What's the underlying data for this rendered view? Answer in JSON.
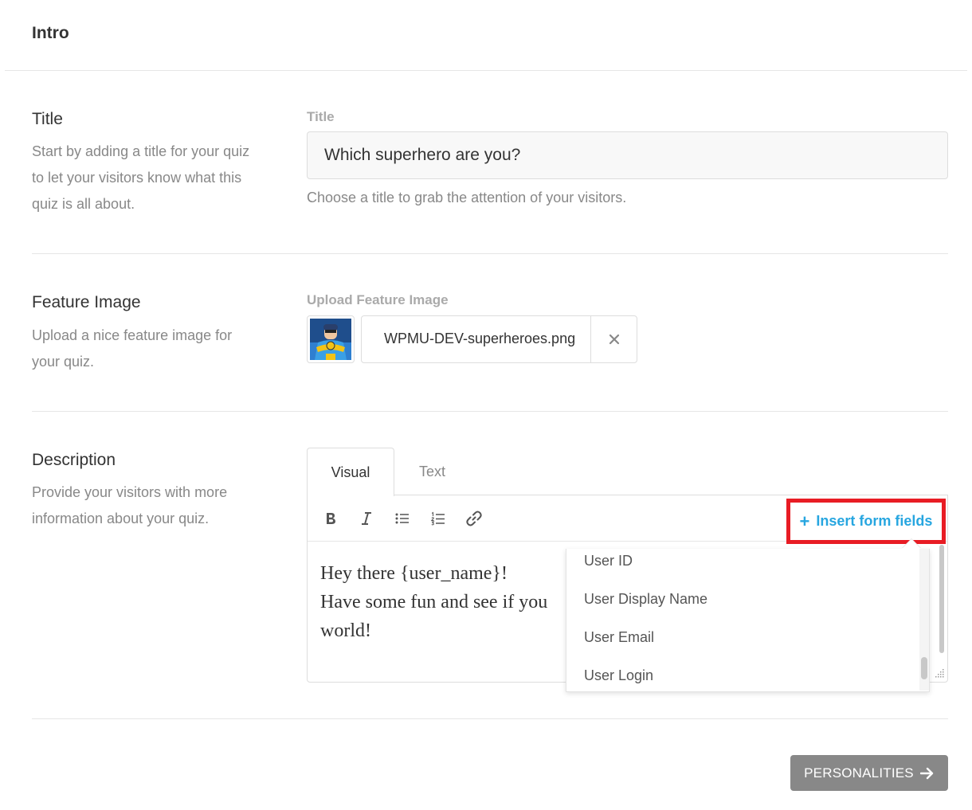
{
  "header": {
    "title": "Intro"
  },
  "title_section": {
    "heading": "Title",
    "description": [
      "Start by adding a title for your quiz",
      "to let your visitors know what this",
      "quiz is all about."
    ],
    "field_label": "Title",
    "value": "Which superhero are you?",
    "help": "Choose a title to grab the attention of your visitors."
  },
  "feature_image_section": {
    "heading": "Feature Image",
    "description": [
      "Upload a nice feature image for",
      "your quiz."
    ],
    "field_label": "Upload Feature Image",
    "file_name": "WPMU-DEV-superheroes.png",
    "remove_icon": "close-icon"
  },
  "description_section": {
    "heading": "Description",
    "description": [
      "Provide your visitors with more",
      "information about your quiz."
    ],
    "tabs": [
      {
        "label": "Visual",
        "active": true
      },
      {
        "label": "Text",
        "active": false
      }
    ],
    "toolbar": {
      "icons": [
        "bold-icon",
        "italic-icon",
        "bullet-list-icon",
        "numbered-list-icon",
        "link-icon"
      ],
      "insert_label": "Insert form fields"
    },
    "content_lines": [
      "Hey there {user_name}!",
      "Have some fun and see if you",
      "world!"
    ],
    "dropdown_items": [
      "User ID",
      "User Display Name",
      "User Email",
      "User Login"
    ]
  },
  "footer": {
    "next_label": "PERSONALITIES"
  },
  "colors": {
    "accent": "#27a6e0",
    "highlight": "#e81c24",
    "button": "#888888"
  }
}
